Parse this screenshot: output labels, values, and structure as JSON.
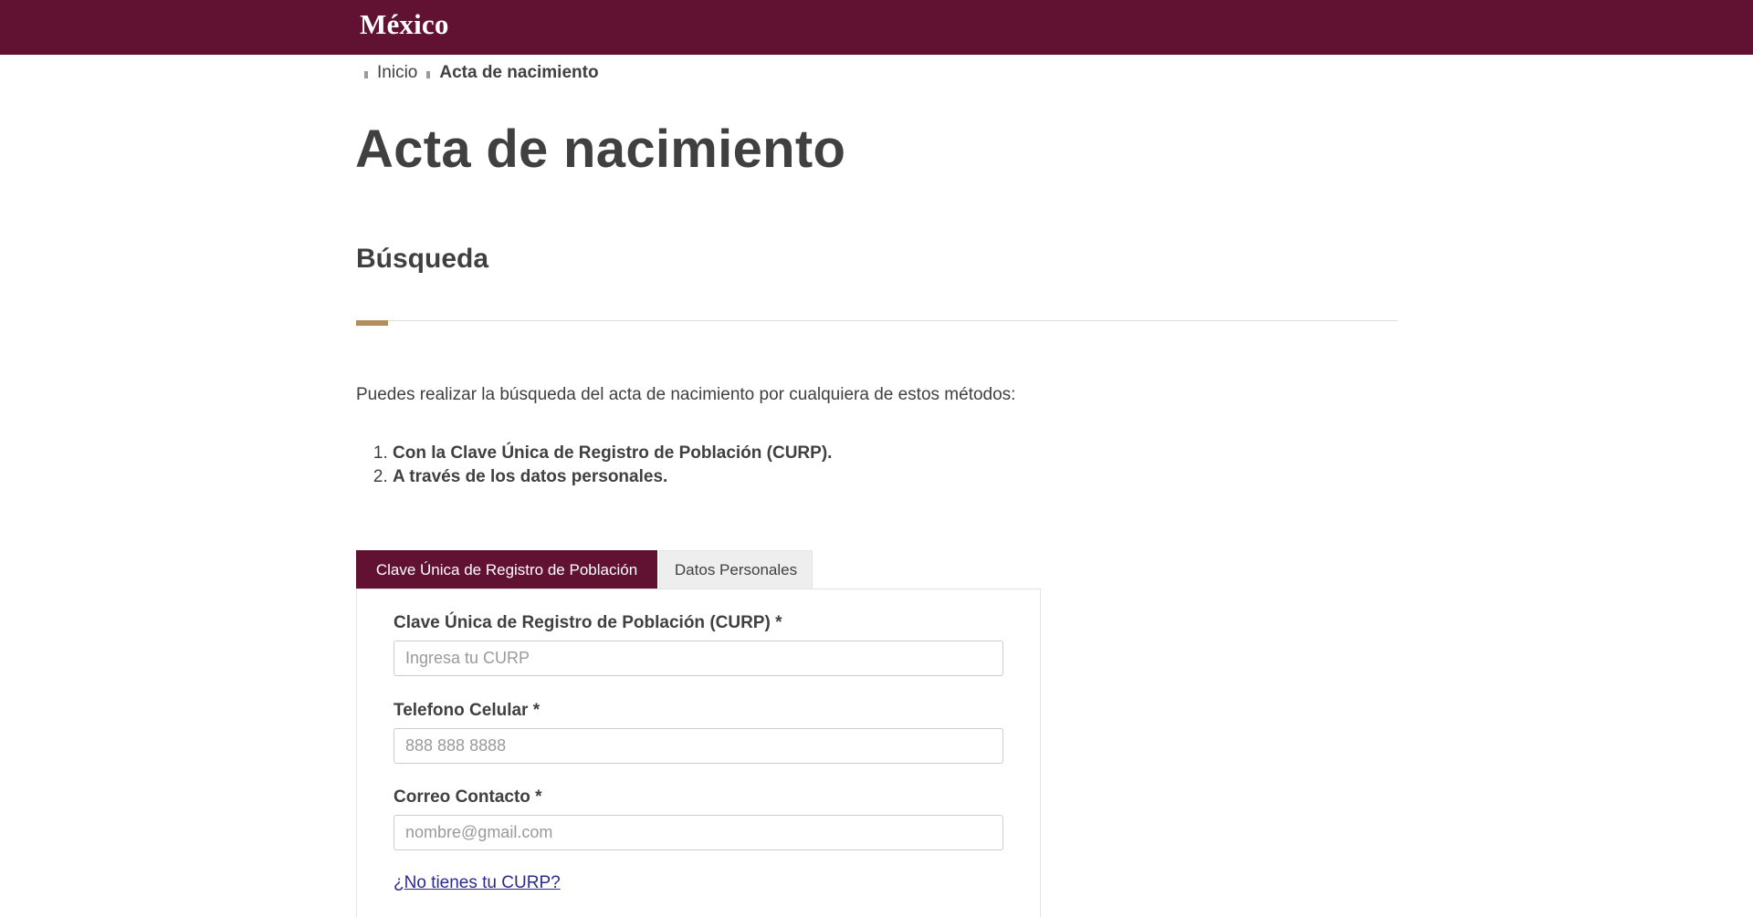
{
  "header": {
    "brand": "México"
  },
  "breadcrumb": {
    "home": "Inicio",
    "current": "Acta de nacimiento"
  },
  "page": {
    "title": "Acta de nacimiento",
    "section_title": "Búsqueda",
    "intro": "Puedes realizar la búsqueda del acta de nacimiento por cualquiera de estos métodos:",
    "methods": [
      "Con la Clave Única de Registro de Población (CURP).",
      "A través de los datos personales."
    ]
  },
  "tabs": [
    {
      "label": "Clave Única de Registro de Población",
      "active": true
    },
    {
      "label": "Datos Personales",
      "active": false
    }
  ],
  "form": {
    "curp_label": "Clave Única de Registro de Población (CURP) *",
    "curp_placeholder": "Ingresa tu CURP",
    "curp_value": "",
    "phone_label": "Telefono Celular *",
    "phone_placeholder": "888 888 8888",
    "phone_value": "",
    "email_label": "Correo Contacto *",
    "email_placeholder": "nombre@gmail.com",
    "email_value": "",
    "no_curp_link": "¿No tienes tu CURP?"
  },
  "colors": {
    "brand": "#611232",
    "accent": "#b38e5d",
    "text": "#404041"
  }
}
